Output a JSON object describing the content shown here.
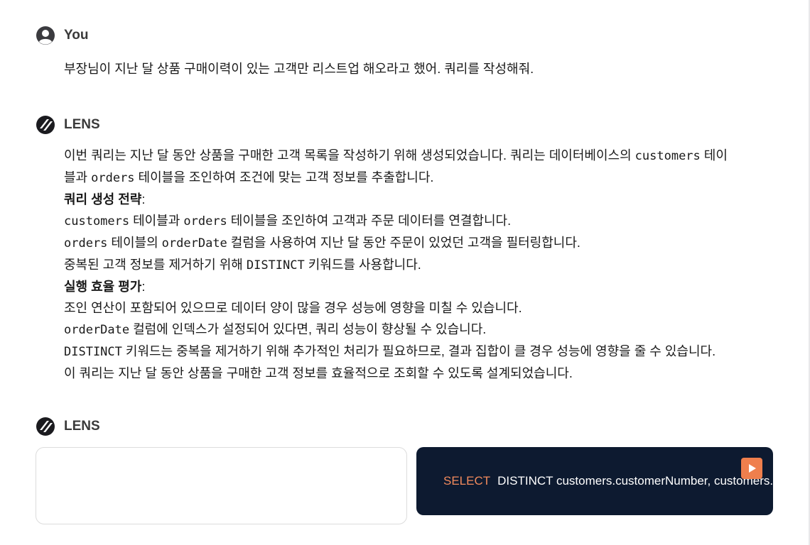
{
  "user_message": {
    "sender": "You",
    "text": "부장님이 지난 달 상품 구매이력이 있는 고객만 리스트업 해오라고 했어. 쿼리를 작성해줘."
  },
  "assistant_message": {
    "sender": "LENS",
    "intro_1a": "이번 쿼리는 지난 달 동안 상품을 구매한 고객 목록을 작성하기 위해 생성되었습니다. 쿼리는 데이터베이스의 ",
    "intro_1b": "customers",
    "intro_1c": " 테이",
    "intro_2a": "블과 ",
    "intro_2b": "orders",
    "intro_2c": " 테이블을 조인하여 조건에 맞는 고객 정보를 추출합니다.",
    "strategy_heading": "쿼리 생성 전략",
    "strategy_colon": ":",
    "s1a": "customers",
    "s1b": " 테이블과 ",
    "s1c": "orders",
    "s1d": " 테이블을 조인하여 고객과 주문 데이터를 연결합니다.",
    "s2a": "orders",
    "s2b": " 테이블의 ",
    "s2c": "orderDate",
    "s2d": " 컬럼을 사용하여 지난 달 동안 주문이 있었던 고객을 필터링합니다.",
    "s3a": "중복된 고객 정보를 제거하기 위해 ",
    "s3b": "DISTINCT",
    "s3c": " 키워드를 사용합니다.",
    "efficiency_heading": "실행 효율 평가",
    "efficiency_colon": ":",
    "e1": "조인 연산이 포함되어 있으므로 데이터 양이 많을 경우 성능에 영향을 미칠 수 있습니다.",
    "e2a": "orderDate",
    "e2b": " 컬럼에 인덱스가 설정되어 있다면, 쿼리 성능이 향상될 수 있습니다.",
    "e3a": "DISTINCT",
    "e3b": " 키워드는 중복을 제거하기 위해 추가적인 처리가 필요하므로, 결과 집합이 클 경우 성능에 영향을 줄 수 있습니다.",
    "closing": "이 쿼리는 지난 달 동안 상품을 구매한 고객 정보를 효율적으로 조회할 수 있도록 설계되었습니다."
  },
  "code_message": {
    "sender": "LENS",
    "sql_keyword": "SELECT",
    "sql_rest": "DISTINCT  customers.customerNumber,  customers.customerName",
    "run_icon": "play-icon"
  },
  "colors": {
    "code_bg": "#0d1a30",
    "keyword": "#f28a5c",
    "run_button": "#ef7f4d"
  }
}
